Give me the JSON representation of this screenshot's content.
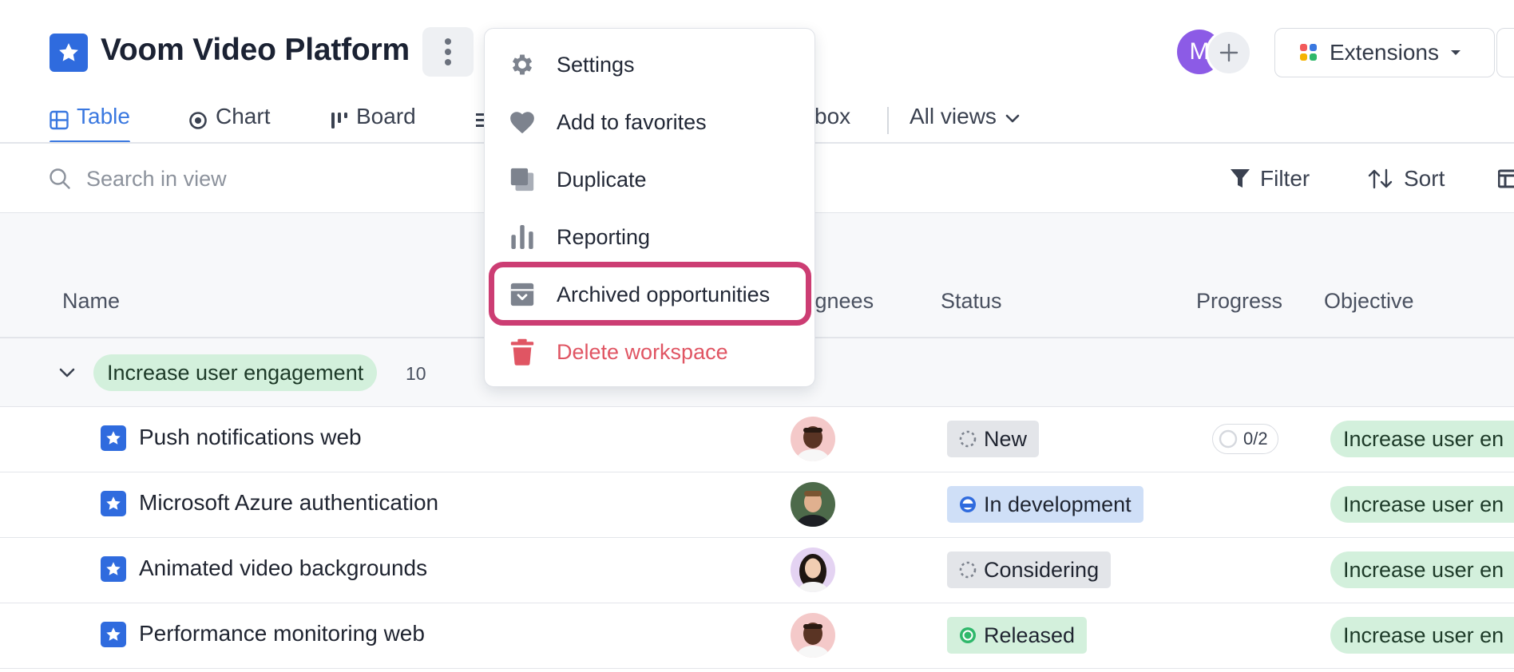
{
  "header": {
    "title": "Voom Video Platform",
    "avatar_initial": "M",
    "extensions_label": "Extensions"
  },
  "tabs": [
    {
      "label": "Table",
      "active": true
    },
    {
      "label": "Chart",
      "active": false
    },
    {
      "label": "Board",
      "active": false
    },
    {
      "label": "box",
      "active": false
    },
    {
      "label": "All views",
      "active": false
    }
  ],
  "toolbar": {
    "search_placeholder": "Search in view",
    "filter_label": "Filter",
    "sort_label": "Sort"
  },
  "columns": [
    "Name",
    "signees",
    "Status",
    "Progress",
    "Objective"
  ],
  "group": {
    "label": "Increase user engagement",
    "count": "10"
  },
  "rows": [
    {
      "name": "Push notifications web",
      "status": "New",
      "progress": "0/2",
      "objective": "Increase user en"
    },
    {
      "name": "Microsoft Azure authentication",
      "status": "In development",
      "progress": "",
      "objective": "Increase user en"
    },
    {
      "name": "Animated video backgrounds",
      "status": "Considering",
      "progress": "",
      "objective": "Increase user en"
    },
    {
      "name": "Performance monitoring web",
      "status": "Released",
      "progress": "",
      "objective": "Increase user en"
    }
  ],
  "menu": {
    "items": [
      {
        "label": "Settings",
        "icon": "gear-icon"
      },
      {
        "label": "Add to favorites",
        "icon": "heart-icon"
      },
      {
        "label": "Duplicate",
        "icon": "duplicate-icon"
      },
      {
        "label": "Reporting",
        "icon": "bar-chart-icon"
      },
      {
        "label": "Archived opportunities",
        "icon": "archive-icon"
      },
      {
        "label": "Delete workspace",
        "icon": "trash-icon"
      }
    ]
  },
  "colors": {
    "accent": "#3a78e0",
    "brand_icon": "#2f6bde",
    "highlight": "#cc3d73",
    "danger": "#e05563",
    "objective_pill": "#d3f0dc",
    "status_new": "#e3e5e9",
    "status_in_development": "#cfdff7",
    "status_considering": "#e3e5e9",
    "status_released": "#d3f0dc"
  }
}
